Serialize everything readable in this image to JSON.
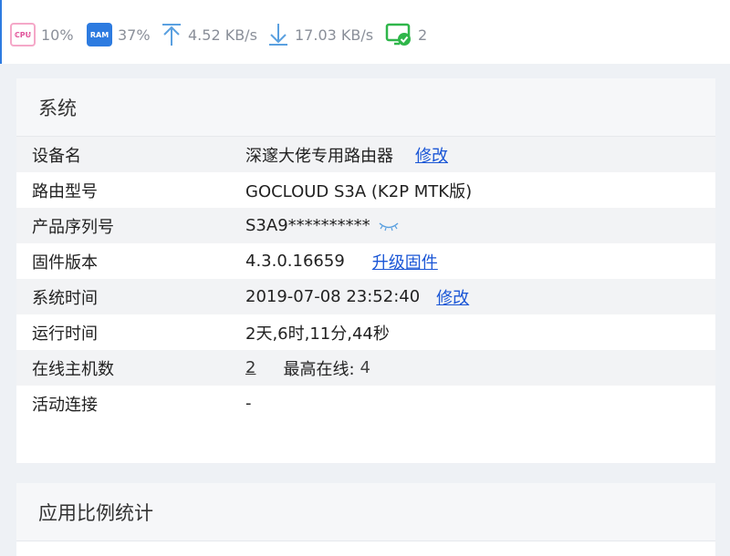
{
  "status": {
    "cpu": {
      "icon_text": "CPU",
      "value": "10%"
    },
    "ram": {
      "icon_text": "RAM",
      "value": "37%"
    },
    "upload": {
      "value": "4.52 KB/s"
    },
    "download": {
      "value": "17.03 KB/s"
    },
    "online_hosts": {
      "value": "2"
    },
    "colors": {
      "cpu": "#e0539a",
      "ram": "#2d7be0",
      "arrow": "#5aa0e0",
      "host": "#2fb64a"
    }
  },
  "system": {
    "title": "系统",
    "rows": {
      "device_name": {
        "label": "设备名",
        "value": "深邃大佬专用路由器",
        "action": "修改"
      },
      "model": {
        "label": "路由型号",
        "value": "GOCLOUD S3A (K2P MTK版)"
      },
      "serial": {
        "label": "产品序列号",
        "value": "S3A9**********"
      },
      "firmware": {
        "label": "固件版本",
        "value": "4.3.0.16659",
        "action": "升级固件"
      },
      "system_time": {
        "label": "系统时间",
        "value": "2019-07-08 23:52:40",
        "action": "修改"
      },
      "uptime": {
        "label": "运行时间",
        "value": "2天,6时,11分,44秒"
      },
      "online_hosts": {
        "label": "在线主机数",
        "value": "2",
        "peak_label": "最高在线:",
        "peak_value": "4"
      },
      "active_connections": {
        "label": "活动连接",
        "value": "-"
      }
    }
  },
  "apps": {
    "title": "应用比例统计"
  }
}
